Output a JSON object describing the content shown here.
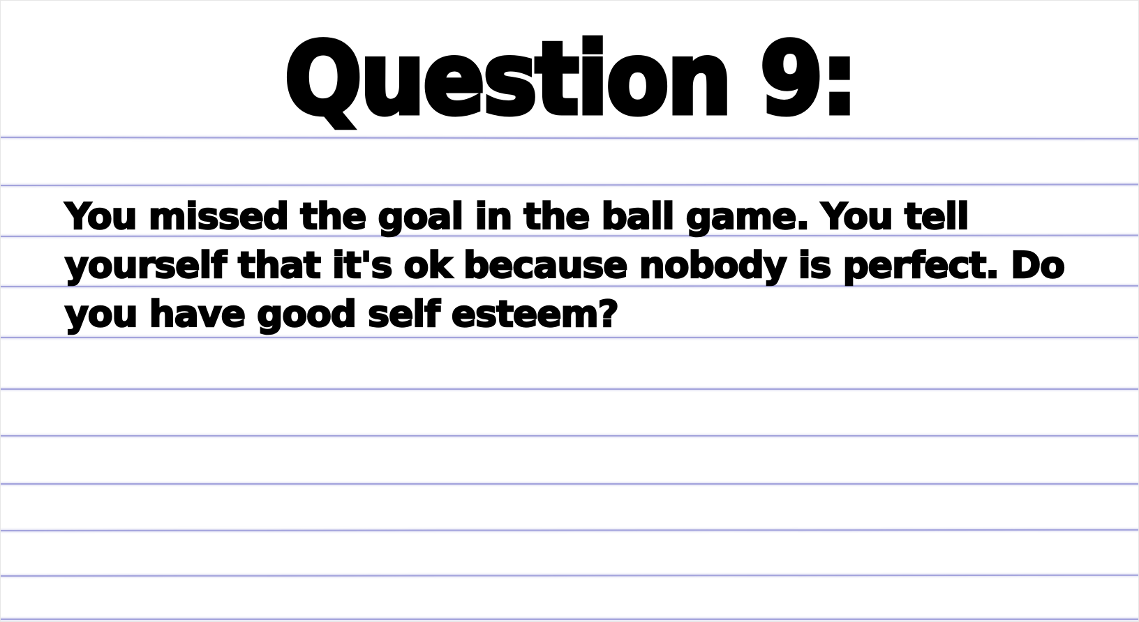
{
  "slide": {
    "title": "Question 9:",
    "question": "You missed the goal in the ball game. You tell yourself that it's ok because nobody is perfect. Do you have good self esteem?"
  },
  "colors": {
    "background": "#ffffff",
    "rule_lines": "#a3a3dc",
    "text": "#000000"
  }
}
